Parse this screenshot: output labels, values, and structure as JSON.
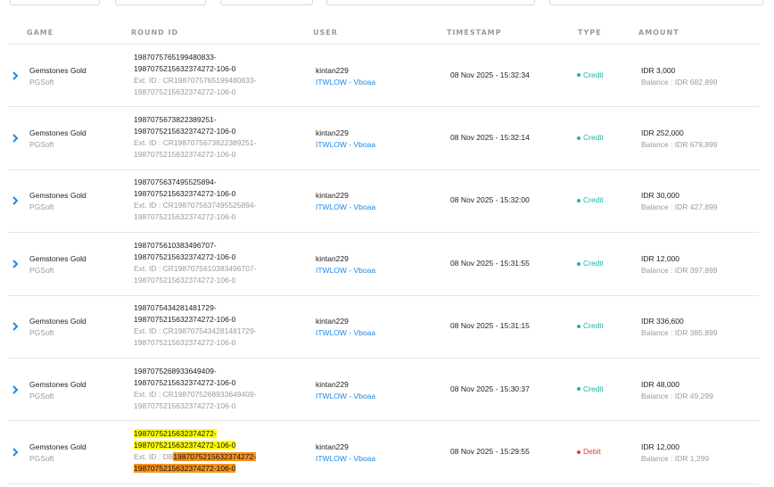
{
  "columns": {
    "game": "GAME",
    "round_id": "ROUND ID",
    "user": "USER",
    "timestamp": "TIMESTAMP",
    "type": "TYPE",
    "amount": "AMOUNT"
  },
  "rows": [
    {
      "game": "Gemstones Gold",
      "provider": "PGSoft",
      "round_line1": "1987075765199480833-",
      "round_line2": "1987075215632374272-106-0",
      "ext_line1": "Ext. ID : CR1987075765199480833-",
      "ext_line2": "1987075215632374272-106-0",
      "user": "kintan229",
      "agent": "ITWLOW - Vboaa",
      "timestamp": "08 Nov 2025 - 15:32:34",
      "type": "Credit",
      "amount": "IDR 3,000",
      "balance": "Balance : IDR 682,899"
    },
    {
      "game": "Gemstones Gold",
      "provider": "PGSoft",
      "round_line1": "1987075673822389251-",
      "round_line2": "1987075215632374272-106-0",
      "ext_line1": "Ext. ID : CR1987075673822389251-",
      "ext_line2": "1987075215632374272-106-0",
      "user": "kintan229",
      "agent": "ITWLOW - Vboaa",
      "timestamp": "08 Nov 2025 - 15:32:14",
      "type": "Credit",
      "amount": "IDR 252,000",
      "balance": "Balance : IDR 679,899"
    },
    {
      "game": "Gemstones Gold",
      "provider": "PGSoft",
      "round_line1": "1987075637495525894-",
      "round_line2": "1987075215632374272-106-0",
      "ext_line1": "Ext. ID : CR1987075637495525894-",
      "ext_line2": "1987075215632374272-106-0",
      "user": "kintan229",
      "agent": "ITWLOW - Vboaa",
      "timestamp": "08 Nov 2025 - 15:32:00",
      "type": "Credit",
      "amount": "IDR 30,000",
      "balance": "Balance : IDR 427,899"
    },
    {
      "game": "Gemstones Gold",
      "provider": "PGSoft",
      "round_line1": "1987075610383496707-",
      "round_line2": "1987075215632374272-106-0",
      "ext_line1": "Ext. ID : CR1987075610383496707-",
      "ext_line2": "1987075215632374272-106-0",
      "user": "kintan229",
      "agent": "ITWLOW - Vboaa",
      "timestamp": "08 Nov 2025 - 15:31:55",
      "type": "Credit",
      "amount": "IDR 12,000",
      "balance": "Balance : IDR 397,899"
    },
    {
      "game": "Gemstones Gold",
      "provider": "PGSoft",
      "round_line1": "1987075434281481729-",
      "round_line2": "1987075215632374272-106-0",
      "ext_line1": "Ext. ID : CR1987075434281481729-",
      "ext_line2": "1987075215632374272-106-0",
      "user": "kintan229",
      "agent": "ITWLOW - Vboaa",
      "timestamp": "08 Nov 2025 - 15:31:15",
      "type": "Credit",
      "amount": "IDR 336,600",
      "balance": "Balance : IDR 385,899"
    },
    {
      "game": "Gemstones Gold",
      "provider": "PGSoft",
      "round_line1": "1987075268933649409-",
      "round_line2": "1987075215632374272-106-0",
      "ext_line1": "Ext. ID : CR1987075268933649409-",
      "ext_line2": "1987075215632374272-106-0",
      "user": "kintan229",
      "agent": "ITWLOW - Vboaa",
      "timestamp": "08 Nov 2025 - 15:30:37",
      "type": "Credit",
      "amount": "IDR 48,000",
      "balance": "Balance : IDR 49,299"
    }
  ],
  "last_row": {
    "game": "Gemstones Gold",
    "provider": "PGSoft",
    "round_line1": "1987075215632374272-",
    "round_line2": "1987075215632374272-106-0",
    "ext_prefix": "Ext. ID : DB",
    "ext_line1_hl": "1987075215632374272-",
    "ext_line2": "1987075215632374272-106-0",
    "user": "kintan229",
    "agent": "ITWLOW - Vboaa",
    "timestamp": "08 Nov 2025 - 15:29:55",
    "type": "Debit",
    "amount": "IDR 12,000",
    "balance": "Balance : IDR 1,299"
  },
  "colors": {
    "credit": "#17b6a4",
    "debit": "#e53935",
    "link": "#1e88e5",
    "highlight_yellow": "#ffff00",
    "highlight_orange": "#f7931e"
  },
  "icons": {
    "expand": "chevron-right-icon"
  }
}
